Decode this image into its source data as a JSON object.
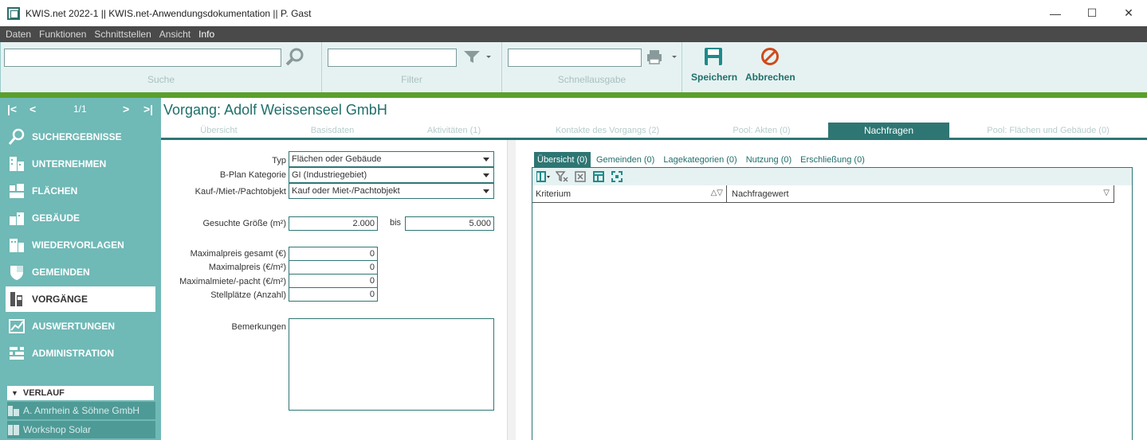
{
  "window": {
    "title": "KWIS.net 2022-1 || KWIS.net-Anwendungsdokumentation || P. Gast",
    "minimize": "—",
    "maximize": "☐",
    "close": "✕"
  },
  "menu": [
    "Daten",
    "Funktionen",
    "Schnittstellen",
    "Ansicht",
    "Info"
  ],
  "toolbar": {
    "search_label": "Suche",
    "search_value": "",
    "filter_label": "Filter",
    "filter_value": "",
    "quick_label": "Schnellausgabe",
    "quick_value": "",
    "save_label": "Speichern",
    "cancel_label": "Abbrechen"
  },
  "pager": {
    "first": "|<",
    "prev": "<",
    "position": "1/1",
    "next": ">",
    "last": ">|"
  },
  "nav": [
    {
      "label": "SUCHERGEBNISSE",
      "icon": "search-icon",
      "active": false
    },
    {
      "label": "UNTERNEHMEN",
      "icon": "building-icon",
      "active": false
    },
    {
      "label": "FLÄCHEN",
      "icon": "area-icon",
      "active": false
    },
    {
      "label": "GEBÄUDE",
      "icon": "house-icon",
      "active": false
    },
    {
      "label": "WIEDERVORLAGEN",
      "icon": "calendar-icon",
      "active": false
    },
    {
      "label": "GEMEINDEN",
      "icon": "shield-icon",
      "active": false
    },
    {
      "label": "VORGÄNGE",
      "icon": "folder-icon",
      "active": true
    },
    {
      "label": "AUSWERTUNGEN",
      "icon": "chart-icon",
      "active": false
    },
    {
      "label": "ADMINISTRATION",
      "icon": "settings-icon",
      "active": false
    }
  ],
  "verlauf": {
    "title": "VERLAUF",
    "items": [
      "A. Amrhein & Söhne GmbH",
      "Workshop Solar"
    ]
  },
  "main": {
    "title": "Vorgang: Adolf Weissenseel GmbH",
    "tabs": [
      "Übersicht",
      "Basisdaten",
      "Aktivitäten (1)",
      "Kontakte des Vorgangs (2)",
      "Pool: Akten (0)",
      "Nachfragen",
      "Pool: Flächen und Gebäude (0)"
    ],
    "active_tab": "Nachfragen"
  },
  "form": {
    "typ_label": "Typ",
    "typ_value": "Flächen oder Gebäude",
    "bplan_label": "B-Plan Kategorie",
    "bplan_value": "GI (Industriegebiet)",
    "kauf_label": "Kauf-/Miet-/Pachtobjekt",
    "kauf_value": "Kauf oder Miet-/Pachtobjekt",
    "groesse_label": "Gesuchte Größe (m²)",
    "groesse_from": "2.000",
    "bis_label": "bis",
    "groesse_to": "5.000",
    "max_gesamt_label": "Maximalpreis gesamt (€)",
    "max_gesamt_value": "0",
    "max_preis_label": "Maximalpreis (€/m²)",
    "max_preis_value": "0",
    "max_miete_label": "Maximalmiete/-pacht (€/m²)",
    "max_miete_value": "0",
    "stellplaetze_label": "Stellplätze (Anzahl)",
    "stellplaetze_value": "0",
    "bemerkungen_label": "Bemerkungen",
    "bemerkungen_value": ""
  },
  "subtabs": [
    "Übersicht (0)",
    "Gemeinden (0)",
    "Lagekategorien (0)",
    "Nutzung (0)",
    "Erschließung (0)"
  ],
  "grid": {
    "col1": "Kriterium",
    "col2": "Nachfragewert"
  },
  "colors": {
    "accent": "#2e7673",
    "sidebar": "#6fb9b6",
    "greenbar": "#5aa02c",
    "cancel": "#d04a1a"
  }
}
